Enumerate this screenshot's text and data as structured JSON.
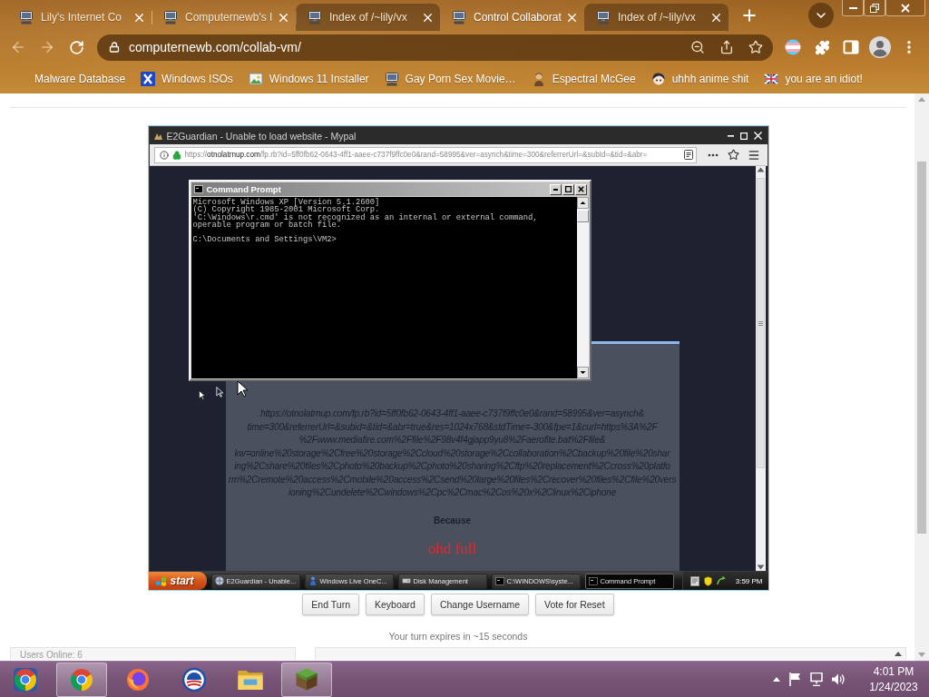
{
  "browser": {
    "tabs": [
      {
        "title": "Lily's Internet Co",
        "selected": false,
        "shaded": false
      },
      {
        "title": "Computernewb's I",
        "selected": false,
        "shaded": false
      },
      {
        "title": "Index of /~lily/vx",
        "selected": false,
        "shaded": true
      },
      {
        "title": "Control Collaborat",
        "selected": true,
        "shaded": false
      },
      {
        "title": "Index of /~lily/vx",
        "selected": false,
        "shaded": true
      }
    ],
    "url": "computernewb.com/collab-vm/",
    "bookmarks": [
      {
        "label": "Malware Database",
        "kind": "blank"
      },
      {
        "label": "Windows ISOs",
        "kind": "cross"
      },
      {
        "label": "Windows 11 Installer",
        "kind": "image"
      },
      {
        "label": "Gay Porn Sex Movie…",
        "kind": "computer"
      },
      {
        "label": "Espectral McGee",
        "kind": "figure"
      },
      {
        "label": "uhhh anime shit",
        "kind": "character"
      },
      {
        "label": "you are an idiot!",
        "kind": "flag"
      }
    ]
  },
  "vm": {
    "window": {
      "title": "E2Guardian - Unable to load website - Mypal",
      "url_scheme": "https://",
      "url_host": "otnolatrnup.com",
      "url_path": "/fp.rb?id=5ff0fb62-0643-4ff1-aaee-c737f9ffc0e0&rand=58995&ver=asynch&time=300&referrerUrl=&subId=&tid=&abr="
    },
    "console": {
      "title": "Command Prompt",
      "output": [
        "Microsoft Windows XP [Version 5.1.2600]",
        "(C) Copyright 1985-2001 Microsoft Corp.",
        "'C:\\Windows\\r.cmd' is not recognized as an internal or external command,",
        "operable program or batch file."
      ],
      "prompt": "C:\\Documents and Settings\\VM2>"
    },
    "block_page": {
      "url_lines": [
        "https://otnolatrnup.com/fp.rb?id=5ff0fb62-0643-4ff1-aaee-c737f9ffc0e0&rand=58995&ver=asynch&",
        "time=300&referrerUrl=&subid=&tid=&abr=true&res=1024x768&stdTime=-300&fpe=1&curl=https%3A%2F",
        "%2Fwww.mediafire.com%2Ffile%2F98v4f4gjapp9yu8%2Faerofite.bat%2Ffile&",
        "kw=online%20storage%2Cfree%20storage%2Ccloud%20storage%2Ccollaboration%2Cbackup%20file%20shar",
        "ing%2Cshare%20files%2Cphoto%20backup%2Cphoto%20sharing%2Cftp%20replacement%2Ccross%20platfo",
        "rm%2Cremote%20access%2Cmobile%20access%2Csend%20large%20files%2Crecover%20files%2Cfile%20vers",
        "ioning%2Cundelete%2Cwindows%2Cpc%2Cmac%2Cos%20x%2Clinux%2Ciphone"
      ],
      "reason_heading": "Because",
      "reason": "ohd full"
    },
    "taskbar": {
      "start": "start",
      "items": [
        {
          "label": "E2Guardian - Unable...",
          "kind": "browser",
          "selected": false
        },
        {
          "label": "Windows Live OneC...",
          "kind": "figure",
          "selected": false
        },
        {
          "label": "Disk Management",
          "kind": "disk",
          "selected": false
        },
        {
          "label": "C:\\WINDOWS\\syste...",
          "kind": "console",
          "selected": false
        },
        {
          "label": "Command Prompt",
          "kind": "console",
          "selected": true
        }
      ],
      "clock": "3:59 PM"
    }
  },
  "controls": {
    "buttons": [
      "End Turn",
      "Keyboard",
      "Change Username",
      "Vote for Reset"
    ],
    "turn_status": "Your turn expires in ~15 seconds",
    "users_online": "Users Online: 6"
  },
  "taskbar": {
    "apps": [
      {
        "kind": "chromium",
        "running": false
      },
      {
        "kind": "chrome",
        "running": true
      },
      {
        "kind": "firefox",
        "running": false
      },
      {
        "kind": "logo",
        "running": false
      },
      {
        "kind": "explorer",
        "running": false
      },
      {
        "kind": "blocks",
        "running": true
      }
    ],
    "time": "4:01 PM",
    "date": "1/24/2023"
  }
}
